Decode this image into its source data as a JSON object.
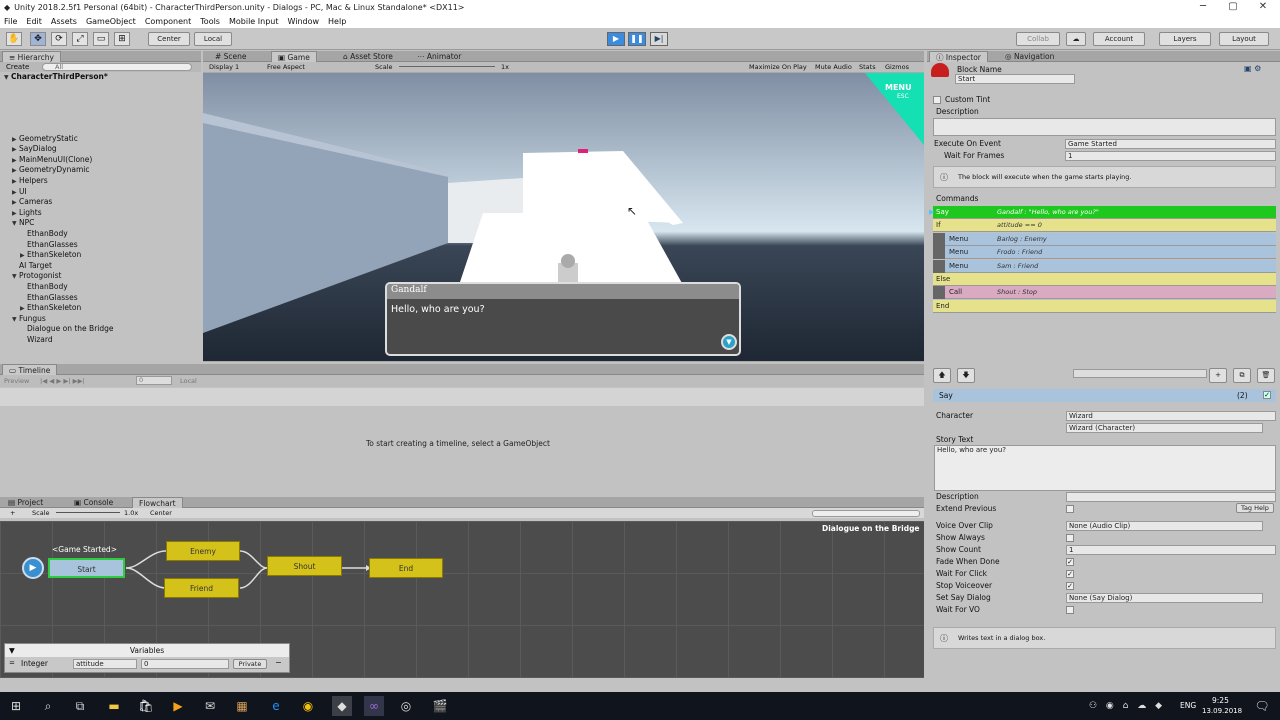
{
  "window": {
    "title": "Unity 2018.2.5f1 Personal (64bit) - CharacterThirdPerson.unity - Dialogs - PC, Mac & Linux Standalone* <DX11>"
  },
  "menu": [
    "File",
    "Edit",
    "Assets",
    "GameObject",
    "Component",
    "Tools",
    "Mobile Input",
    "Window",
    "Help"
  ],
  "toolbar": {
    "center": "Center",
    "local": "Local",
    "collab": "Collab",
    "account": "Account",
    "layers": "Layers",
    "layout": "Layout"
  },
  "hierarchy": {
    "tab": "Hierarchy",
    "create": "Create",
    "search_placeholder": "All",
    "scene": "CharacterThirdPerson*",
    "items": [
      {
        "label": "GeometryStatic",
        "indent": 1,
        "arrow": "▶"
      },
      {
        "label": "SayDialog",
        "indent": 1,
        "arrow": "▶"
      },
      {
        "label": "MainMenuUI(Clone)",
        "indent": 1,
        "arrow": "▶"
      },
      {
        "label": "GeometryDynamic",
        "indent": 1,
        "arrow": "▶"
      },
      {
        "label": "Helpers",
        "indent": 1,
        "arrow": "▶"
      },
      {
        "label": "UI",
        "indent": 1,
        "arrow": "▶"
      },
      {
        "label": "Cameras",
        "indent": 1,
        "arrow": "▶"
      },
      {
        "label": "Lights",
        "indent": 1,
        "arrow": "▶"
      },
      {
        "label": "NPC",
        "indent": 1,
        "arrow": "▼"
      },
      {
        "label": "EthanBody",
        "indent": 2,
        "arrow": ""
      },
      {
        "label": "EthanGlasses",
        "indent": 2,
        "arrow": ""
      },
      {
        "label": "EthanSkeleton",
        "indent": 2,
        "arrow": "▶"
      },
      {
        "label": "AI Target",
        "indent": 1,
        "arrow": ""
      },
      {
        "label": "Protogonist",
        "indent": 1,
        "arrow": "▼"
      },
      {
        "label": "EthanBody",
        "indent": 2,
        "arrow": ""
      },
      {
        "label": "EthanGlasses",
        "indent": 2,
        "arrow": ""
      },
      {
        "label": "EthanSkeleton",
        "indent": 2,
        "arrow": "▶"
      },
      {
        "label": "Fungus",
        "indent": 1,
        "arrow": "▼"
      },
      {
        "label": "Dialogue on the Bridge",
        "indent": 2,
        "arrow": ""
      },
      {
        "label": "Wizard",
        "indent": 2,
        "arrow": ""
      }
    ]
  },
  "view_tabs": {
    "scene": "Scene",
    "game": "Game",
    "asset_store": "Asset Store",
    "animator": "Animator"
  },
  "game_bar": {
    "display": "Display 1",
    "aspect": "Free Aspect",
    "scale_label": "Scale",
    "scale_value": "1x",
    "maximize": "Maximize On Play",
    "mute": "Mute Audio",
    "stats": "Stats",
    "gizmos": "Gizmos"
  },
  "game": {
    "menu_label": "MENU",
    "menu_sub": "ESC",
    "speaker": "Gandalf",
    "dialog_text": "Hello, who are you?"
  },
  "timeline": {
    "tab": "Timeline",
    "preview": "Preview",
    "frame": "0",
    "local": "Local",
    "message": "To start creating a timeline, select a GameObject"
  },
  "bottom_tabs": {
    "project": "Project",
    "console": "Console",
    "flowchart": "Flowchart"
  },
  "flowchart": {
    "scale_label": "Scale",
    "scale_value": "1.0x",
    "center": "Center",
    "title": "Dialogue on the Bridge",
    "event_label": "<Game Started>",
    "blocks": {
      "start": "Start",
      "enemy": "Enemy",
      "friend": "Friend",
      "shout": "Shout",
      "end": "End"
    },
    "variables_title": "Variables",
    "variable": {
      "type": "Integer",
      "name": "attitude",
      "value": "0",
      "scope": "Private"
    }
  },
  "inspector": {
    "tab": "Inspector",
    "nav_tab": "Navigation",
    "block_name_label": "Block Name",
    "block_name": "Start",
    "custom_tint": "Custom Tint",
    "description": "Description",
    "execute_label": "Execute On Event",
    "execute_value": "Game Started",
    "wait_label": "Wait For Frames",
    "wait_value": "1",
    "info": "The block will execute when the game starts playing.",
    "commands_title": "Commands",
    "commands": [
      {
        "name": "Say",
        "summary": "Gandalf : \"Hello, who are you?\"",
        "color": "#1ec81e",
        "indent": 0
      },
      {
        "name": "If",
        "summary": "attitude == 0",
        "color": "#e6e28c",
        "indent": 0
      },
      {
        "name": "Menu",
        "summary": "Barlog : Enemy",
        "color": "#a9c3dc",
        "indent": 1
      },
      {
        "name": "Menu",
        "summary": "Frodo : Friend",
        "color": "#a9c3dc",
        "indent": 1
      },
      {
        "name": "Menu",
        "summary": "Sam : Friend",
        "color": "#a9c3dc",
        "indent": 1
      },
      {
        "name": "Else",
        "summary": "",
        "color": "#e6e28c",
        "indent": 0
      },
      {
        "name": "Call",
        "summary": "Shout : Stop",
        "color": "#d9aac2",
        "indent": 1
      },
      {
        "name": "End",
        "summary": "",
        "color": "#e6e28c",
        "indent": 0
      }
    ],
    "say": {
      "header": "Say",
      "count": "(2)",
      "character_label": "Character",
      "character_value": "Wizard",
      "character_object": "Wizard (Character)",
      "story_label": "Story Text",
      "story_text": "Hello, who are you?",
      "description_label": "Description",
      "extend_label": "Extend Previous",
      "tag_help": "Tag Help",
      "voice_label": "Voice Over Clip",
      "voice_value": "None (Audio Clip)",
      "show_always": "Show Always",
      "show_count": "Show Count",
      "show_count_value": "1",
      "fade": "Fade When Done",
      "wait_click": "Wait For Click",
      "stop_voice": "Stop Voiceover",
      "set_say": "Set Say Dialog",
      "set_say_value": "None (Say Dialog)",
      "wait_vo": "Wait For VO",
      "info": "Writes text in a dialog box."
    }
  },
  "taskbar": {
    "lang": "ENG",
    "time": "9:25",
    "date": "13.09.2018"
  }
}
